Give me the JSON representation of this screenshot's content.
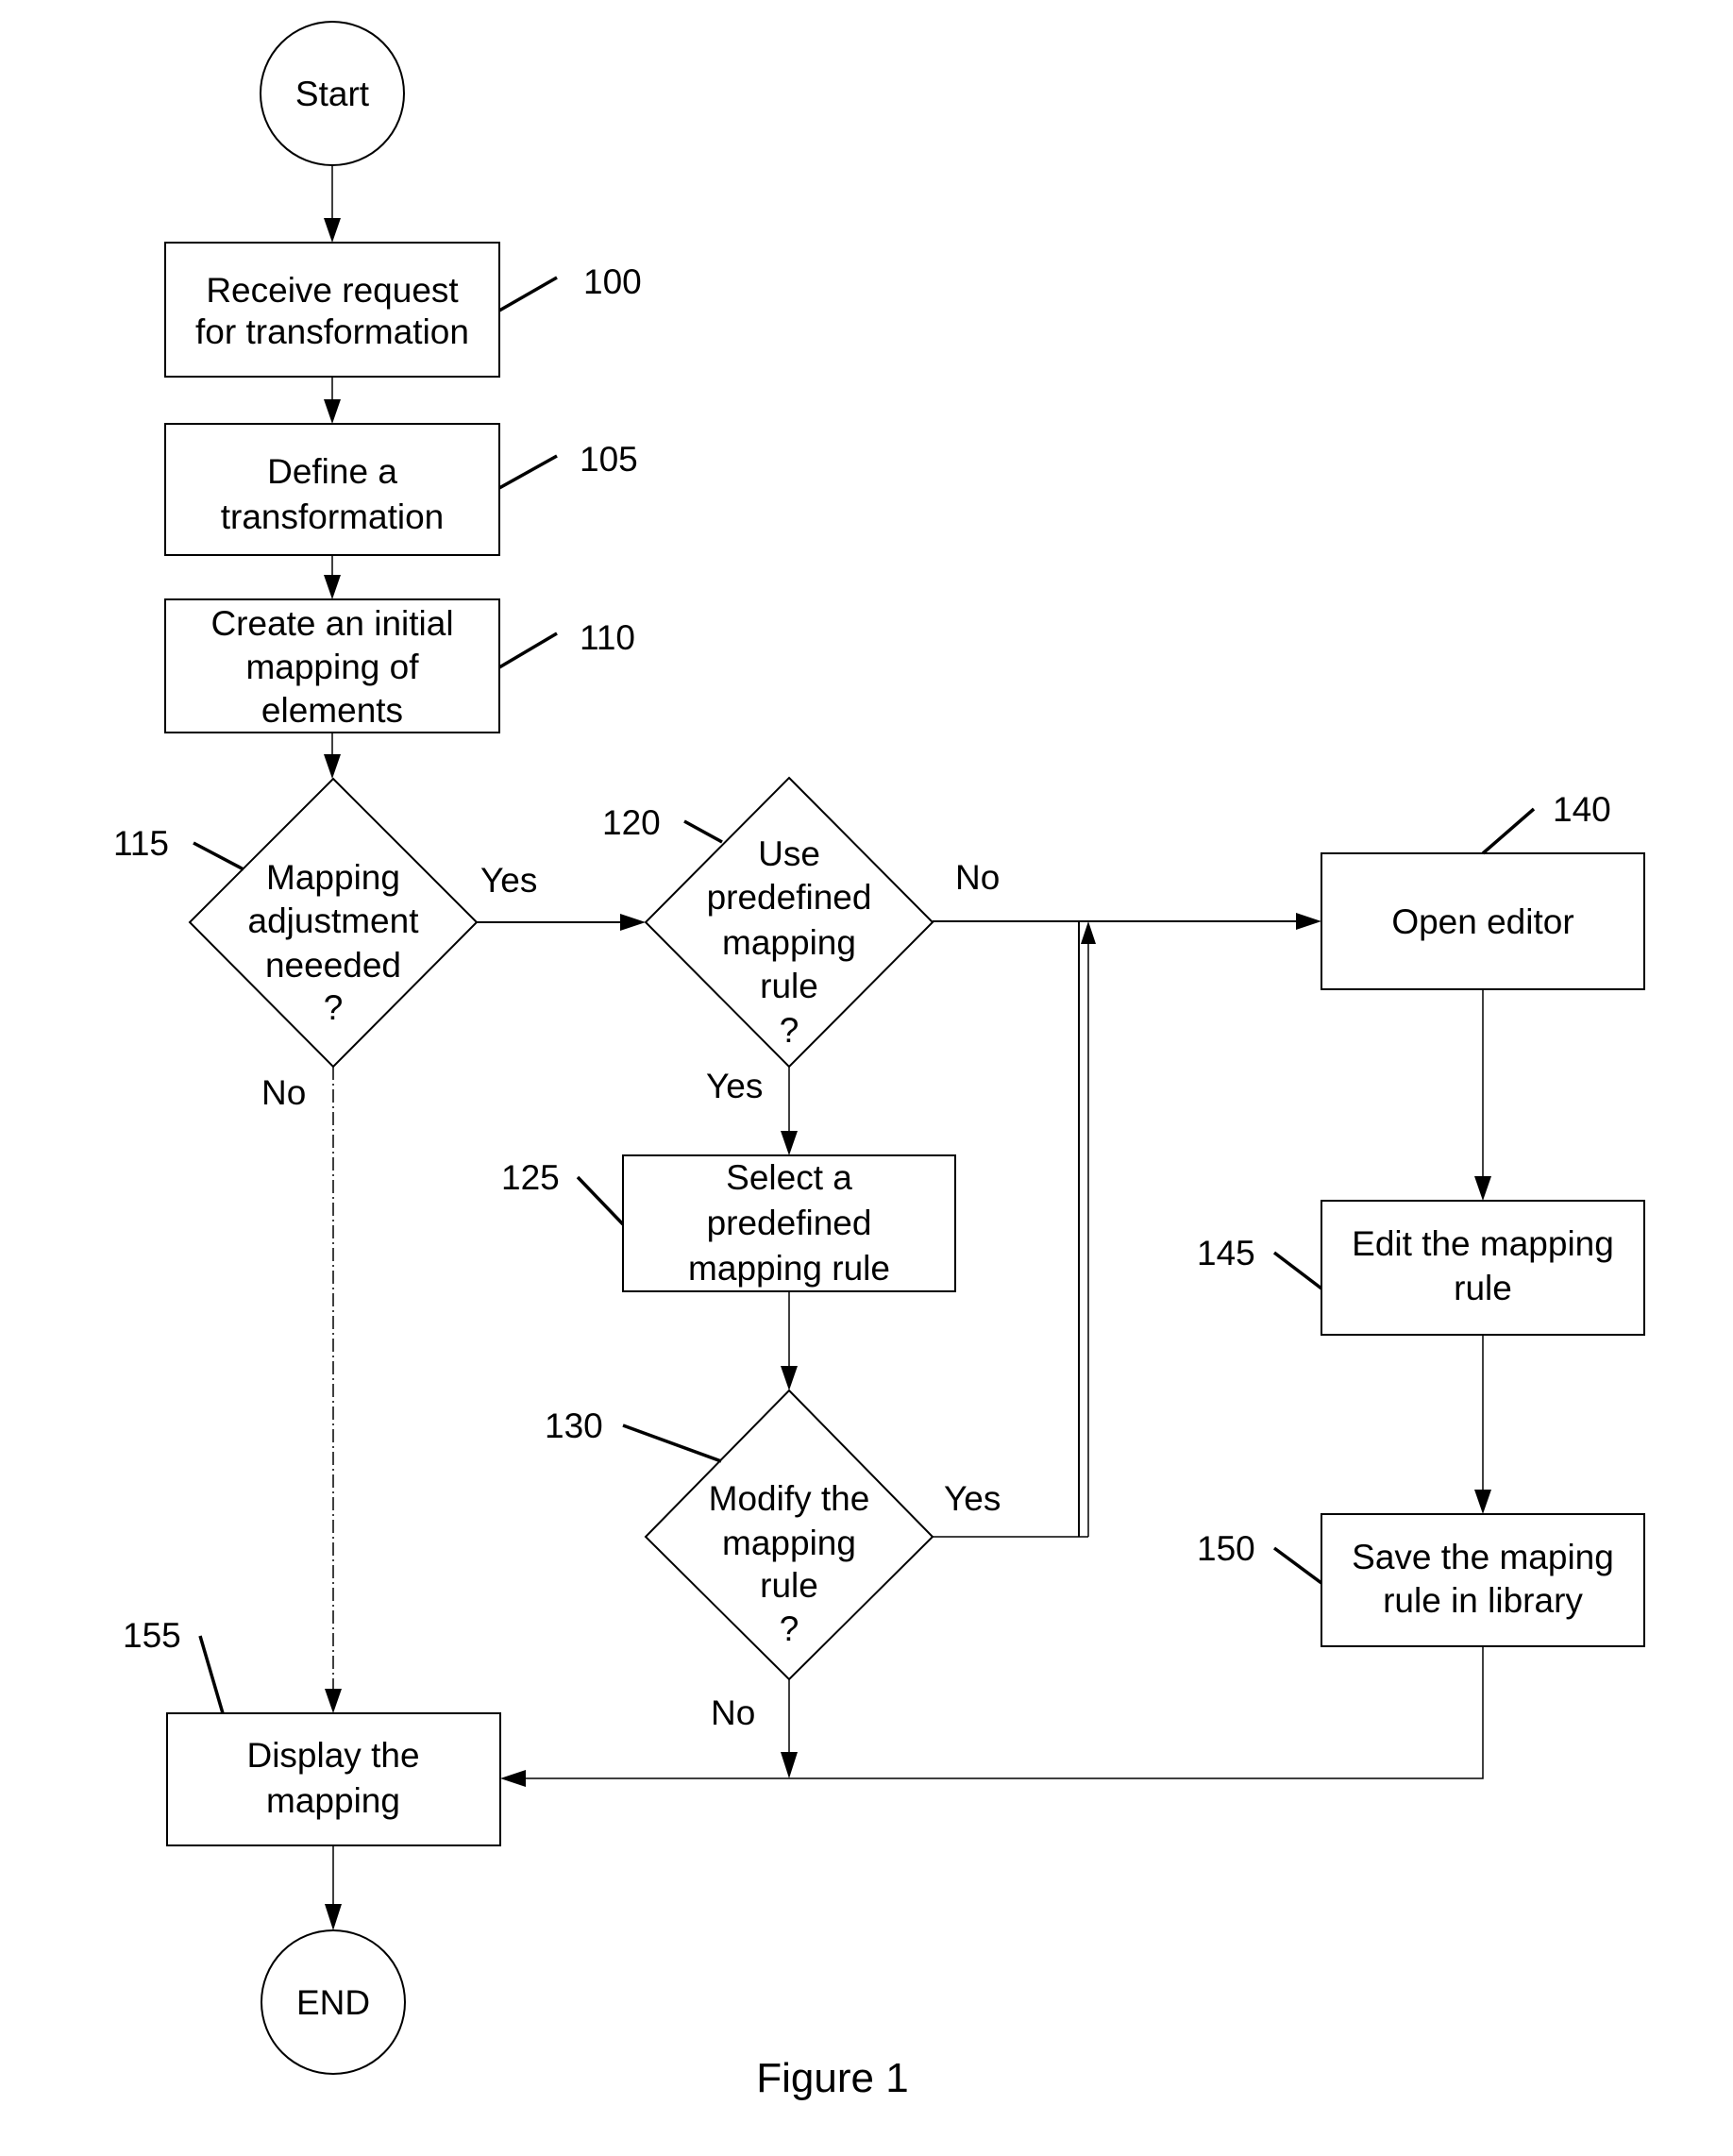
{
  "figure": {
    "caption": "Figure 1",
    "type": "flowchart"
  },
  "nodes": {
    "start": {
      "label": "Start",
      "shape": "circle"
    },
    "n100": {
      "ref": "100",
      "shape": "process",
      "lines": [
        "Receive request",
        "for transformation"
      ]
    },
    "n105": {
      "ref": "105",
      "shape": "process",
      "lines": [
        "Define a",
        "transformation"
      ]
    },
    "n110": {
      "ref": "110",
      "shape": "process",
      "lines": [
        "Create an initial",
        "mapping of",
        "elements"
      ]
    },
    "n115": {
      "ref": "115",
      "shape": "decision",
      "lines": [
        "Mapping",
        "adjustment",
        "neeeded",
        "?"
      ]
    },
    "n120": {
      "ref": "120",
      "shape": "decision",
      "lines": [
        "Use",
        "predefined",
        "mapping",
        "rule",
        "?"
      ]
    },
    "n125": {
      "ref": "125",
      "shape": "process",
      "lines": [
        "Select a",
        "predefined",
        "mapping rule"
      ]
    },
    "n130": {
      "ref": "130",
      "shape": "decision",
      "lines": [
        "Modify the",
        "mapping",
        "rule",
        "?"
      ]
    },
    "n140": {
      "ref": "140",
      "shape": "process",
      "lines": [
        "Open editor"
      ]
    },
    "n145": {
      "ref": "145",
      "shape": "process",
      "lines": [
        "Edit the mapping",
        "rule"
      ]
    },
    "n150": {
      "ref": "150",
      "shape": "process",
      "lines": [
        "Save the maping",
        "rule in library"
      ]
    },
    "n155": {
      "ref": "155",
      "shape": "process",
      "lines": [
        "Display the",
        "mapping"
      ]
    },
    "end": {
      "label": "END",
      "shape": "circle"
    }
  },
  "edges": [
    {
      "from": "start",
      "to": "n100",
      "label": ""
    },
    {
      "from": "n100",
      "to": "n105",
      "label": ""
    },
    {
      "from": "n105",
      "to": "n110",
      "label": ""
    },
    {
      "from": "n110",
      "to": "n115",
      "label": ""
    },
    {
      "from": "n115",
      "to": "n120",
      "label": "Yes"
    },
    {
      "from": "n115",
      "to": "n155",
      "label": "No"
    },
    {
      "from": "n120",
      "to": "n140",
      "label": "No"
    },
    {
      "from": "n120",
      "to": "n125",
      "label": "Yes"
    },
    {
      "from": "n125",
      "to": "n130",
      "label": ""
    },
    {
      "from": "n130",
      "to": "n140",
      "label": "Yes"
    },
    {
      "from": "n130",
      "to": "n155",
      "label": "No"
    },
    {
      "from": "n140",
      "to": "n145",
      "label": ""
    },
    {
      "from": "n145",
      "to": "n150",
      "label": ""
    },
    {
      "from": "n150",
      "to": "n155",
      "label": ""
    },
    {
      "from": "n155",
      "to": "end",
      "label": ""
    }
  ],
  "edge_labels": {
    "yes_115": "Yes",
    "no_115": "No",
    "no_120": "No",
    "yes_120": "Yes",
    "yes_130": "Yes",
    "no_130": "No"
  }
}
